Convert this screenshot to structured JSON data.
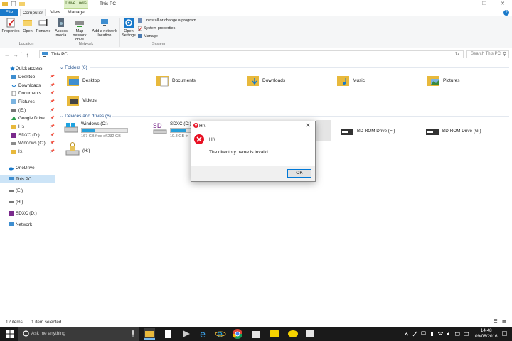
{
  "window": {
    "title": "This PC",
    "contextual_tab": "Drive Tools"
  },
  "ribbon": {
    "tabs": [
      "File",
      "Computer",
      "View",
      "Manage"
    ],
    "buttons": {
      "properties": "Properties",
      "open": "Open",
      "rename": "Rename",
      "access_media": "Access media",
      "map_network_drive": "Map network drive",
      "add_network_location": "Add a network location",
      "open_settings": "Open Settings"
    },
    "small_buttons": [
      "Uninstall or change a program",
      "System properties",
      "Manage"
    ],
    "groups": {
      "location": "Location",
      "network": "Network",
      "system": "System"
    }
  },
  "address": {
    "path": "This PC",
    "search_placeholder": "Search This PC"
  },
  "sidebar": {
    "items": [
      {
        "label": "Quick access",
        "pinned": false
      },
      {
        "label": "Desktop",
        "pinned": true
      },
      {
        "label": "Downloads",
        "pinned": true
      },
      {
        "label": "Documents",
        "pinned": true
      },
      {
        "label": "Pictures",
        "pinned": true
      },
      {
        "label": "(E:)",
        "pinned": true
      },
      {
        "label": "Google Drive",
        "pinned": true
      },
      {
        "label": "H:\\",
        "pinned": true
      },
      {
        "label": "SDXC (D:)",
        "pinned": true
      },
      {
        "label": "Windows (C:)",
        "pinned": true
      },
      {
        "label": "I:\\",
        "pinned": true
      },
      {
        "label": "OneDrive",
        "pinned": false
      },
      {
        "label": "This PC",
        "pinned": false
      },
      {
        "label": "(E:)",
        "pinned": false
      },
      {
        "label": "(H:)",
        "pinned": false
      },
      {
        "label": "SDXC (D:)",
        "pinned": false
      },
      {
        "label": "Network",
        "pinned": false
      }
    ]
  },
  "folders": {
    "header": "Folders (6)",
    "items": [
      "Desktop",
      "Documents",
      "Downloads",
      "Music",
      "Pictures",
      "Videos"
    ]
  },
  "drives": {
    "header": "Devices and drives (6)",
    "items": [
      {
        "name": "Windows (C:)",
        "space": "167 GB free of 232 GB",
        "used_fraction": 0.28
      },
      {
        "name": "SDXC (D:)",
        "space": "19.8 GB fr",
        "used_fraction": 0.35
      },
      {
        "name": "BD-ROM Drive (F:)"
      },
      {
        "name": "BD-ROM Drive (G:)"
      },
      {
        "name": "(H:)"
      }
    ]
  },
  "dialog": {
    "title": "H:\\",
    "path": "H:\\",
    "message": "The directory name is invalid.",
    "ok_label": "OK"
  },
  "status": {
    "items_count": "12 items",
    "selected": "1 item selected"
  },
  "taskbar": {
    "search_placeholder": "Ask me anything",
    "time": "14:48",
    "date": "09/08/2016"
  },
  "colors": {
    "accent": "#1979ca",
    "selection": "#cce4f7",
    "error": "#e81123",
    "taskbar": "#1a1a1a"
  }
}
